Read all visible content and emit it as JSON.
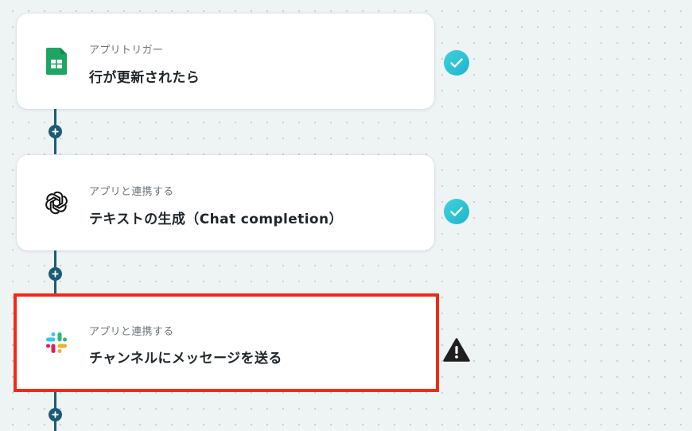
{
  "flow": {
    "steps": [
      {
        "kind": "アプリトリガー",
        "title": "行が更新されたら",
        "app_icon": "google-sheets-icon",
        "status_icon": "check-circle-icon",
        "selected": false
      },
      {
        "kind": "アプリと連携する",
        "title": "テキストの生成（Chat completion）",
        "app_icon": "openai-icon",
        "status_icon": "check-circle-icon",
        "selected": false
      },
      {
        "kind": "アプリと連携する",
        "title": "チャンネルにメッセージを送る",
        "app_icon": "slack-icon",
        "status_icon": "warning-triangle-icon",
        "selected": true
      }
    ]
  },
  "colors": {
    "canvas_bg": "#eef3f4",
    "connector": "#1b5c74",
    "check": "#27c3d4",
    "warning": "#1f1f1f",
    "highlight": "#f12a14",
    "sheets_green": "#1fa463"
  }
}
